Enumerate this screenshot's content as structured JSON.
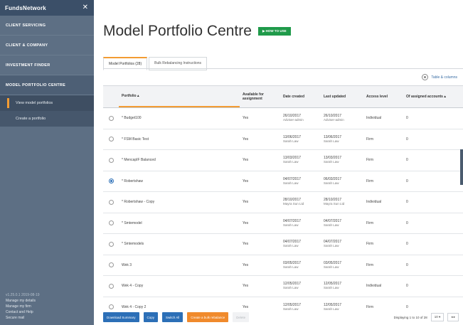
{
  "sidebar": {
    "brand": "FundsNetwork",
    "close_icon": "✕",
    "items": [
      {
        "label": "CLIENT SERVICING"
      },
      {
        "label": "CLIENT & COMPANY"
      },
      {
        "label": "INVESTMENT FINDER"
      },
      {
        "label": "MODEL PORTFOLIO CENTRE"
      }
    ],
    "sub_items": [
      {
        "label": "View model portfolios"
      },
      {
        "label": "Create a portfolio"
      }
    ],
    "footer": {
      "version": "v1.25.0.1 2019-08-19",
      "links": [
        "Manage my details",
        "Manage my firm",
        "Contact and Help",
        "Secure mail"
      ]
    }
  },
  "main": {
    "title": "Model Portfolio Centre",
    "badge": "▶ HOW TO USE",
    "tabs": [
      {
        "label": "Model Portfolios (28)"
      },
      {
        "label": "Bulk Rebalancing Instructions"
      }
    ],
    "settings_link": "Table & columns",
    "table": {
      "headers": {
        "name": "Portfolio ▴",
        "avail": "Available for assignment",
        "created": "Date created",
        "updated": "Last updated",
        "level": "Access level",
        "accounts": "Of assigned accounts ▴"
      },
      "rows": [
        {
          "name": "* Budget100",
          "avail": "Yes",
          "created": "26/10/2017",
          "created_by": "Adviser-admin",
          "updated": "26/10/2017",
          "updated_by": "Adviser-admin",
          "level": "Individual",
          "accounts": "0",
          "selected": false
        },
        {
          "name": "* FSM Basic Test",
          "avail": "Yes",
          "created": "13/06/2017",
          "created_by": "Sarah Law",
          "updated": "13/06/2017",
          "updated_by": "Sarah Law",
          "level": "Firm",
          "accounts": "0",
          "selected": false
        },
        {
          "name": "* MencapIF Balanced",
          "avail": "Yes",
          "created": "13/03/2017",
          "created_by": "Sarah Law",
          "updated": "13/03/2017",
          "updated_by": "Sarah Law",
          "level": "Firm",
          "accounts": "0",
          "selected": false
        },
        {
          "name": "* Robertshaw",
          "avail": "Yes",
          "created": "04/07/2017",
          "created_by": "Sarah Law",
          "updated": "06/03/2017",
          "updated_by": "Sarah Law",
          "level": "Firm",
          "accounts": "0",
          "selected": true
        },
        {
          "name": "* Robertshaw - Copy",
          "avail": "Yes",
          "created": "28/10/2017",
          "created_by": "Mayra Sun Ltd",
          "updated": "28/10/2017",
          "updated_by": "Mayra Sun Ltd",
          "level": "Individual",
          "accounts": "0",
          "selected": false
        },
        {
          "name": "* Smtemodel",
          "avail": "Yes",
          "created": "04/07/2017",
          "created_by": "Sarah Law",
          "updated": "04/07/2017",
          "updated_by": "Sarah Law",
          "level": "Firm",
          "accounts": "0",
          "selected": false
        },
        {
          "name": "* Smtemodels",
          "avail": "Yes",
          "created": "04/07/2017",
          "created_by": "Sarah Law",
          "updated": "04/07/2017",
          "updated_by": "Sarah Law",
          "level": "Firm",
          "accounts": "0",
          "selected": false
        },
        {
          "name": "Wek 3",
          "avail": "Yes",
          "created": "03/05/2017",
          "created_by": "Sarah Law",
          "updated": "03/05/2017",
          "updated_by": "Sarah Law",
          "level": "Firm",
          "accounts": "0",
          "selected": false
        },
        {
          "name": "Wek 4 - Copy",
          "avail": "Yes",
          "created": "12/05/2017",
          "created_by": "Sarah Law",
          "updated": "12/05/2017",
          "updated_by": "Sarah Law",
          "level": "Individual",
          "accounts": "0",
          "selected": false
        },
        {
          "name": "Wek 4 - Copy 2",
          "avail": "Yes",
          "created": "12/05/2017",
          "created_by": "Sarah Law",
          "updated": "12/05/2017",
          "updated_by": "Sarah Law",
          "level": "Firm",
          "accounts": "0",
          "selected": false
        }
      ]
    },
    "bottom": {
      "buttons": [
        {
          "label": "Download Summary",
          "style": "blue"
        },
        {
          "label": "Copy",
          "style": "blue"
        },
        {
          "label": "Switch All",
          "style": "blue"
        },
        {
          "label": "Create a bulk rebalance",
          "style": "orange"
        },
        {
          "label": "Delete",
          "style": "disabled"
        }
      ],
      "pager_text": "Displaying 1 to 10 of 28",
      "per_page": "10 ▾",
      "nav": "◂  ▸"
    }
  },
  "colors": {
    "sidebar": "#5d6f84",
    "accent": "#f39c33",
    "primary": "#2c6fb7",
    "badge": "#1f9a4a"
  }
}
